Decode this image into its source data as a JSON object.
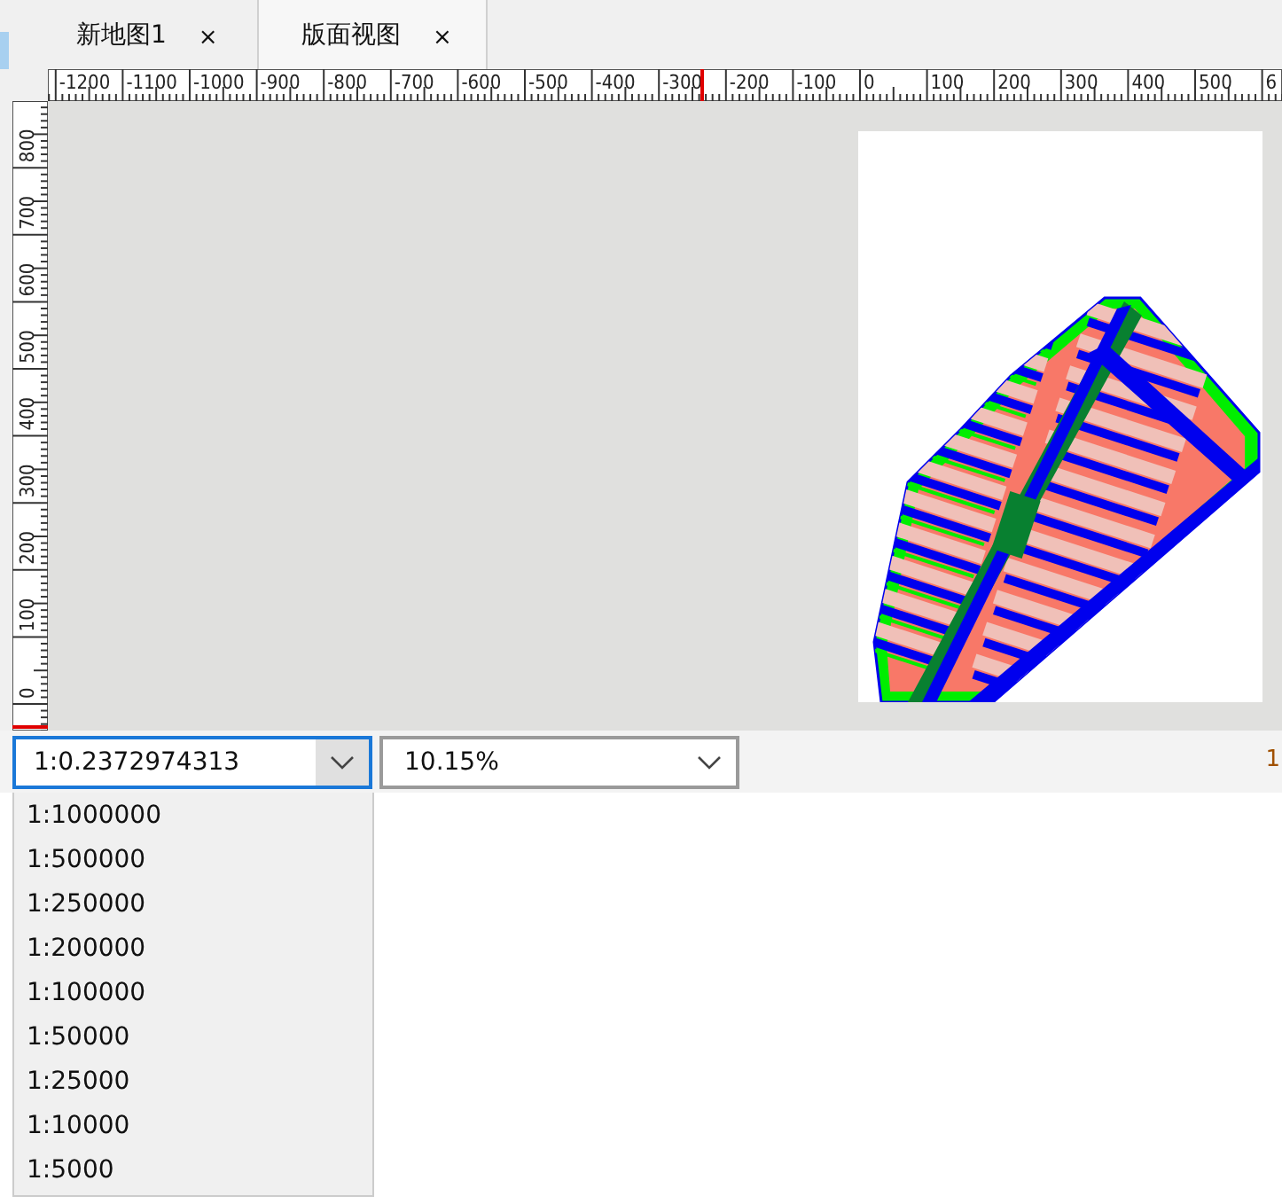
{
  "tabs": [
    {
      "label": "新地图1",
      "close": "×",
      "selected": false
    },
    {
      "label": "版面视图",
      "close": "×",
      "selected": true
    }
  ],
  "ruler_top": {
    "labels": [
      "-1200",
      "-1100",
      "-1000",
      "-900",
      "-800",
      "-700",
      "-600",
      "-500",
      "-400",
      "-300",
      "-200",
      "-100",
      "0",
      "100",
      "200",
      "300",
      "400",
      "500",
      "6"
    ]
  },
  "ruler_left": {
    "labels": [
      "800",
      "700",
      "600",
      "500",
      "400",
      "300",
      "200",
      "100",
      "0"
    ]
  },
  "scale_combo": {
    "value": "1:0.2372974313",
    "expanded": true,
    "options": [
      "1:1000000",
      "1:500000",
      "1:250000",
      "1:200000",
      "1:100000",
      "1:50000",
      "1:25000",
      "1:10000",
      "1:5000"
    ]
  },
  "zoom_combo": {
    "value": "10.15%"
  },
  "edge_text": "1"
}
